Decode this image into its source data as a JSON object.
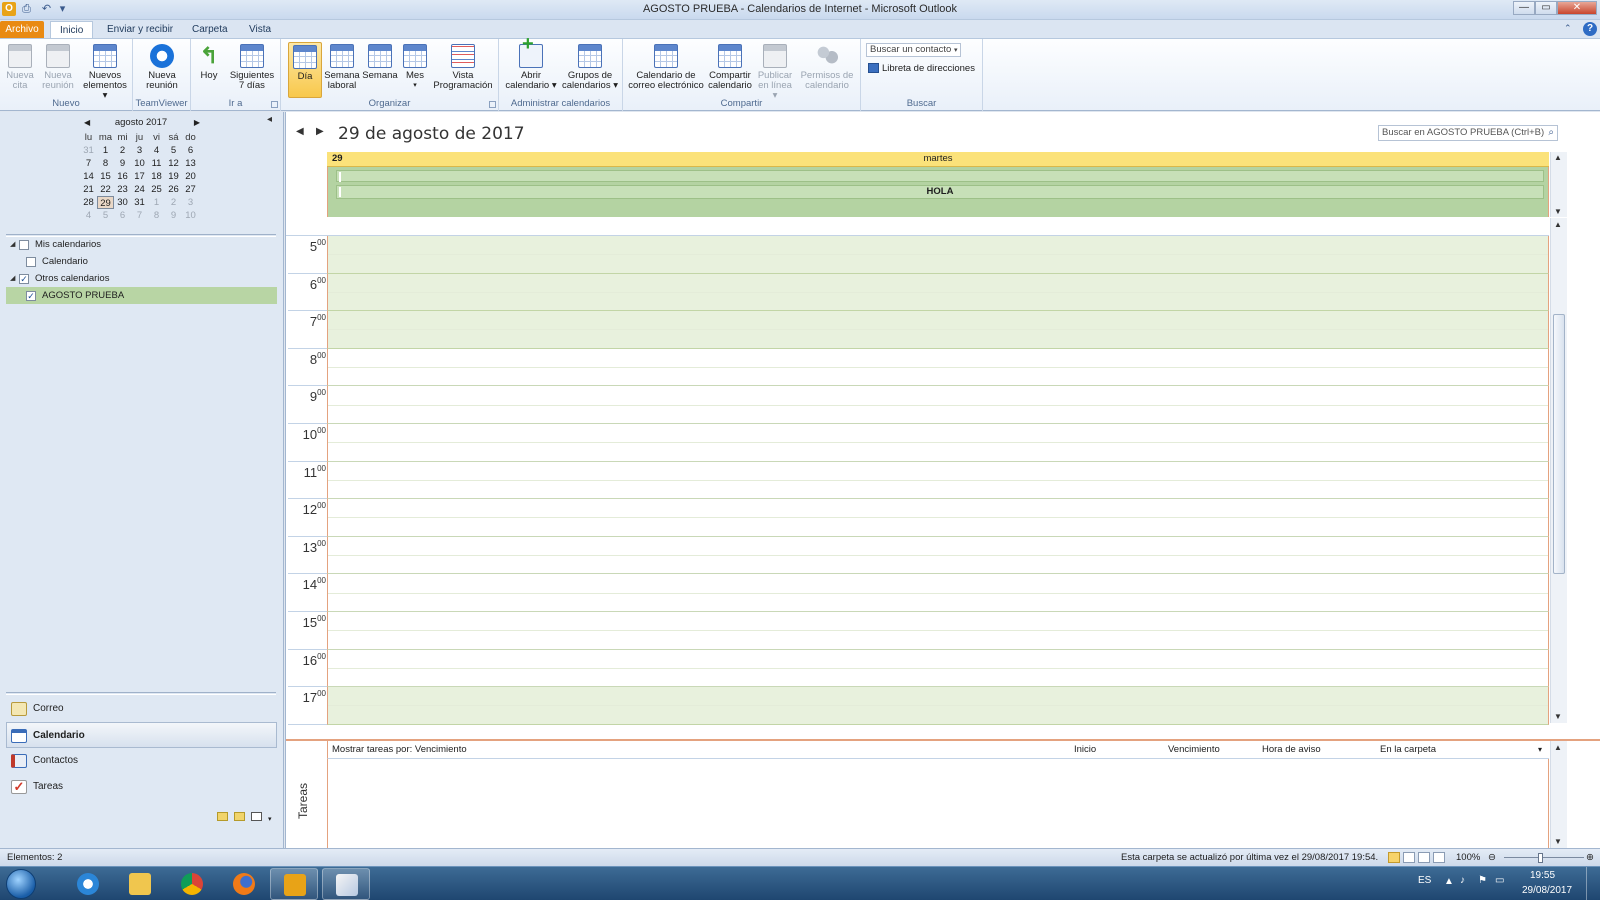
{
  "window": {
    "title": "AGOSTO PRUEBA - Calendarios de Internet - Microsoft Outlook",
    "app_icon": "O",
    "controls": [
      "—",
      "▭",
      "✕"
    ]
  },
  "ribbon_tabs": [
    {
      "label": "Archivo"
    },
    {
      "label": "Inicio"
    },
    {
      "label": "Enviar y recibir"
    },
    {
      "label": "Carpeta"
    },
    {
      "label": "Vista"
    }
  ],
  "ribbon": {
    "nuevo": {
      "label": "Nuevo",
      "nueva_cita": "Nueva cita",
      "nueva_reunion": "Nueva reunión",
      "nuevos_elementos": "Nuevos elementos ▾"
    },
    "teamviewer": {
      "label": "TeamViewer",
      "nueva_reunion": "Nueva reunión"
    },
    "ir_a": {
      "label": "Ir a",
      "hoy": "Hoy",
      "siguientes": "Siguientes 7 días"
    },
    "organizar": {
      "label": "Organizar",
      "dia": "Día",
      "semana_laboral": "Semana laboral",
      "semana": "Semana",
      "mes": "Mes",
      "vista_programacion": "Vista Programación"
    },
    "administrar": {
      "label": "Administrar calendarios",
      "abrir": "Abrir calendario ▾",
      "grupos": "Grupos de calendarios ▾"
    },
    "compartir": {
      "label": "Compartir",
      "correo": "Calendario de correo electrónico",
      "compartir": "Compartir calendario",
      "publicar": "Publicar en línea ▾",
      "permisos": "Permisos de calendario"
    },
    "buscar": {
      "label": "Buscar",
      "buscar_contacto": "Buscar un contacto",
      "libreta": "Libreta de direcciones"
    }
  },
  "mini_calendar": {
    "month": "agosto 2017",
    "weekdays": [
      "lu",
      "ma",
      "mi",
      "ju",
      "vi",
      "sá",
      "do"
    ],
    "weeks": [
      [
        "31",
        "1",
        "2",
        "3",
        "4",
        "5",
        "6"
      ],
      [
        "7",
        "8",
        "9",
        "10",
        "11",
        "12",
        "13"
      ],
      [
        "14",
        "15",
        "16",
        "17",
        "18",
        "19",
        "20"
      ],
      [
        "21",
        "22",
        "23",
        "24",
        "25",
        "26",
        "27"
      ],
      [
        "28",
        "29",
        "30",
        "31",
        "1",
        "2",
        "3"
      ],
      [
        "4",
        "5",
        "6",
        "7",
        "8",
        "9",
        "10"
      ]
    ],
    "today": "29"
  },
  "calendars": {
    "mis": "Mis calendarios",
    "calendario": "Calendario",
    "otros": "Otros calendarios",
    "agosto": "AGOSTO PRUEBA"
  },
  "nav": {
    "correo": "Correo",
    "calendario": "Calendario",
    "contactos": "Contactos",
    "tareas": "Tareas"
  },
  "day_view": {
    "date_title": "29 de agosto de 2017",
    "search_placeholder": "Buscar en AGOSTO PRUEBA (Ctrl+B)",
    "day_number": "29",
    "day_name": "martes",
    "allday_event": "HOLA",
    "hours": [
      {
        "h": "5",
        "m": "00",
        "work": false
      },
      {
        "h": "6",
        "m": "00",
        "work": false
      },
      {
        "h": "7",
        "m": "00",
        "work": false
      },
      {
        "h": "8",
        "m": "00",
        "work": true
      },
      {
        "h": "9",
        "m": "00",
        "work": true
      },
      {
        "h": "10",
        "m": "00",
        "work": true
      },
      {
        "h": "11",
        "m": "00",
        "work": true
      },
      {
        "h": "12",
        "m": "00",
        "work": true
      },
      {
        "h": "13",
        "m": "00",
        "work": true
      },
      {
        "h": "14",
        "m": "00",
        "work": true
      },
      {
        "h": "15",
        "m": "00",
        "work": true
      },
      {
        "h": "16",
        "m": "00",
        "work": true
      },
      {
        "h": "17",
        "m": "00",
        "work": false
      }
    ]
  },
  "tasks": {
    "side_label": "Tareas",
    "show_by": "Mostrar tareas por: Vencimiento",
    "col_inicio": "Inicio",
    "col_vencimiento": "Vencimiento",
    "col_aviso": "Hora de aviso",
    "col_carpeta": "En la carpeta"
  },
  "statusbar": {
    "items": "Elementos: 2",
    "updated": "Esta carpeta se actualizó por última vez el 29/08/2017 19:54.",
    "zoom": "100%"
  },
  "taskbar": {
    "lang": "ES",
    "time": "19:55",
    "date": "29/08/2017"
  },
  "colors": {
    "accent": "#e98a12",
    "day_header": "#fbe27a",
    "allday_bg": "#b4d3a2",
    "offhours": "#e8f1dd",
    "selected_calendar": "#b8d5a4"
  }
}
